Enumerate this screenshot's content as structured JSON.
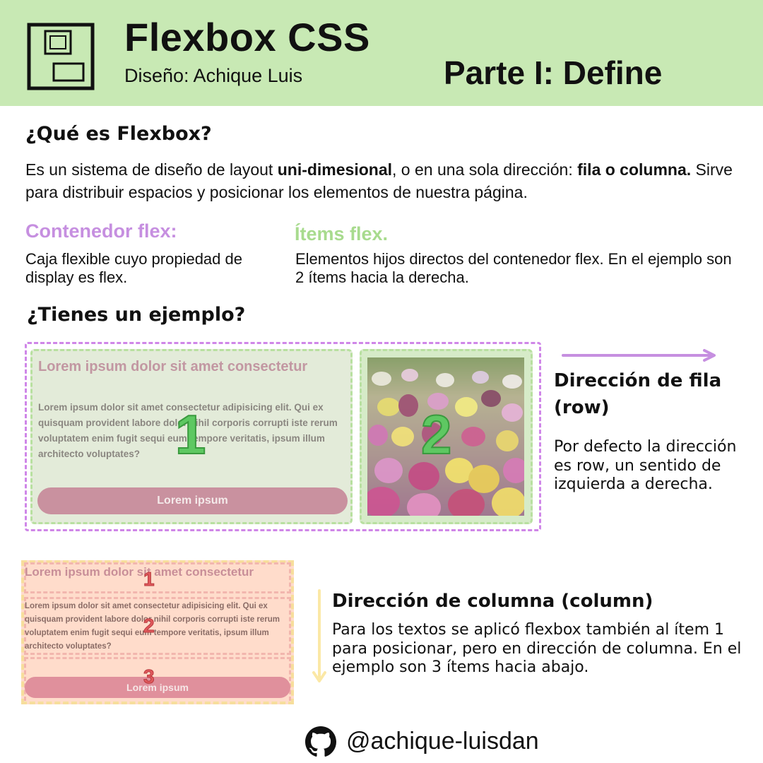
{
  "header": {
    "title": "Flexbox CSS",
    "author": "Diseño: Achique Luis",
    "part": "Parte I: Define",
    "background": "#c8e9b4"
  },
  "intro": {
    "heading": "¿Qué es Flexbox?",
    "text_1": "Es un sistema de diseño de layout ",
    "bold_1": "uni-dimesional",
    "text_2": ", o en una sola dirección: ",
    "bold_2": "fila o columna.",
    "text_3": " Sirve para distribuir espacios y posicionar los elementos de nuestra página."
  },
  "container": {
    "title": "Contenedor flex:",
    "text": "Caja flexible cuyo propiedad de display es flex.",
    "color": "#c68fe0"
  },
  "items": {
    "title": "Ítems flex.",
    "text": "Elementos hijos directos del contenedor flex. En el ejemplo son 2 ítems hacia la derecha.",
    "color": "#a8db8e"
  },
  "example": {
    "heading": "¿Tienes un ejemplo?",
    "card_title": "Lorem ipsum dolor sit amet consectetur",
    "card_body": "Lorem ipsum dolor sit amet consectetur adipisicing elit. Qui ex quisquam provident labore dolor nihil corporis corrupti iste rerum voluptatem enim fugit sequi eum tempore veritatis, ipsum illum architecto voluptates?",
    "card_button": "Lorem ipsum",
    "num_1": "1",
    "num_2": "2"
  },
  "row": {
    "title": "Dirección de fila (row)",
    "text": "Por defecto la dirección es row, un sentido de izquierda a derecha.",
    "arrow_color": "#c68fe0"
  },
  "column": {
    "card_title": "Lorem ipsum dolor sit amet consectetur",
    "card_body": "Lorem ipsum dolor sit amet consectetur adipisicing elit. Qui ex quisquam provident labore dolor nihil corporis corrupti iste rerum voluptatem enim fugit sequi eum tempore veritatis, ipsum illum architecto voluptates?",
    "card_button": "Lorem ipsum",
    "num_1": "1",
    "num_2": "2",
    "num_3": "3",
    "title": "Dirección de columna (column)",
    "text": "Para los textos se aplicó flexbox también al ítem 1 para posicionar, pero en dirección de columna. En el ejemplo son 3 ítems hacia abajo.",
    "arrow_color": "#fbe8a6"
  },
  "footer": {
    "icon": "github-icon",
    "handle": "@achique-luisdan"
  }
}
